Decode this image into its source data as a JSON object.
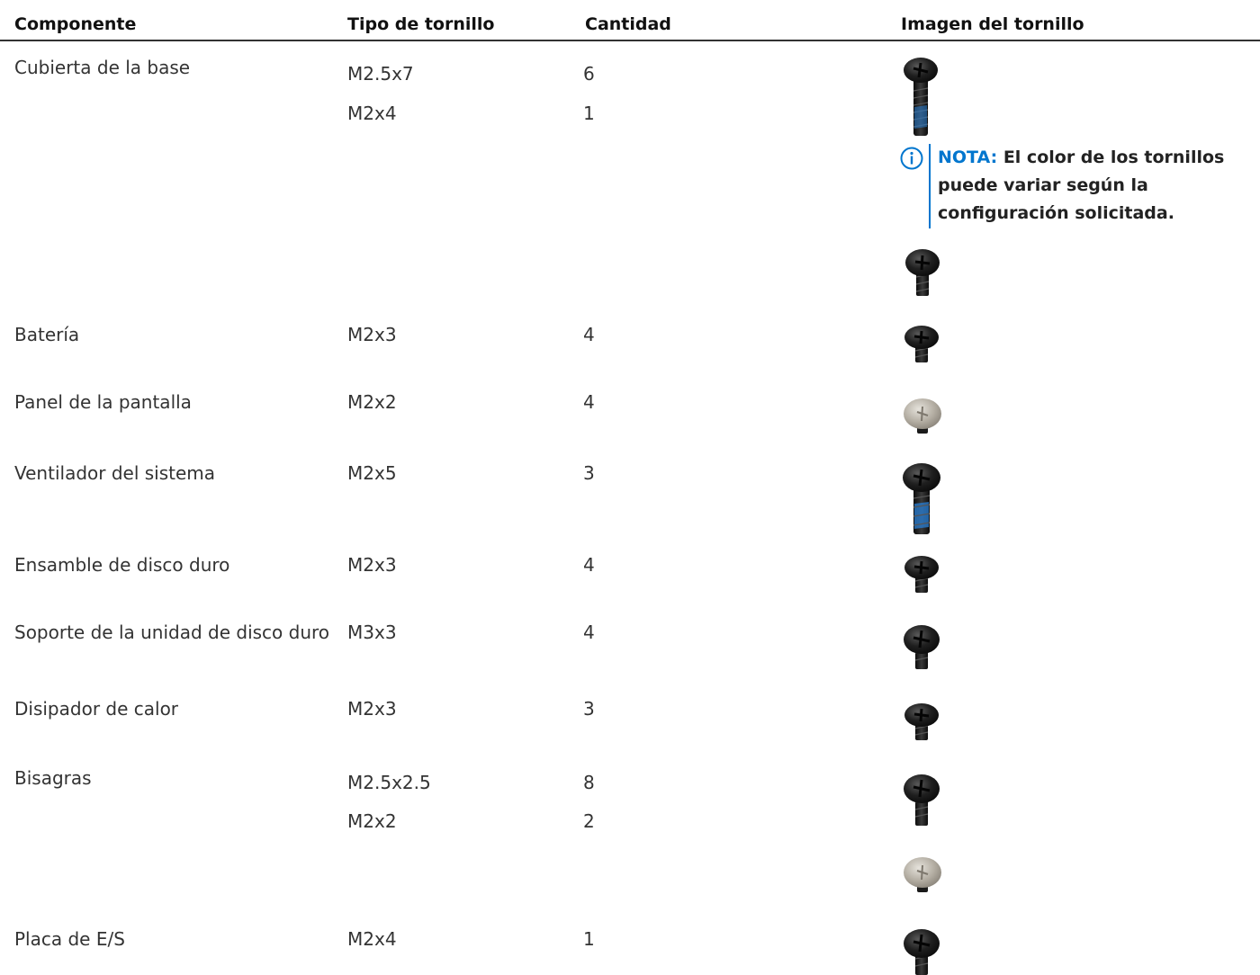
{
  "table": {
    "headers": [
      "Componente",
      "Tipo de tornillo",
      "Cantidad",
      "Imagen del tornillo"
    ],
    "rows": [
      {
        "component": "Cubierta de la base",
        "screws": [
          {
            "type": "M2.5x7",
            "qty": "6"
          },
          {
            "type": "M2x4",
            "qty": "1"
          }
        ]
      },
      {
        "component": "Batería",
        "screws": [
          {
            "type": "M2x3",
            "qty": "4"
          }
        ]
      },
      {
        "component": "Panel de la pantalla",
        "screws": [
          {
            "type": "M2x2",
            "qty": "4"
          }
        ]
      },
      {
        "component": "Ventilador del sistema",
        "screws": [
          {
            "type": "M2x5",
            "qty": "3"
          }
        ]
      },
      {
        "component": "Ensamble de disco duro",
        "screws": [
          {
            "type": "M2x3",
            "qty": "4"
          }
        ]
      },
      {
        "component": "Soporte de la unidad de disco duro",
        "screws": [
          {
            "type": "M3x3",
            "qty": "4"
          }
        ]
      },
      {
        "component": "Disipador de calor",
        "screws": [
          {
            "type": "M2x3",
            "qty": "3"
          }
        ]
      },
      {
        "component": "Bisagras",
        "screws": [
          {
            "type": "M2.5x2.5",
            "qty": "8"
          },
          {
            "type": "M2x2",
            "qty": "2"
          }
        ]
      },
      {
        "component": "Placa de E/S",
        "screws": [
          {
            "type": "M2x4",
            "qty": "1"
          }
        ]
      }
    ]
  },
  "note": {
    "label": "NOTA:",
    "text": "El color de los tornillos puede variar según la configuración solicitada.",
    "icon": "info-icon"
  },
  "colors": {
    "accent": "#0076ce",
    "screw_black": "#1a1a1a",
    "screw_silver": "#b5b0a6",
    "thread_blue": "#2a7fd4"
  }
}
